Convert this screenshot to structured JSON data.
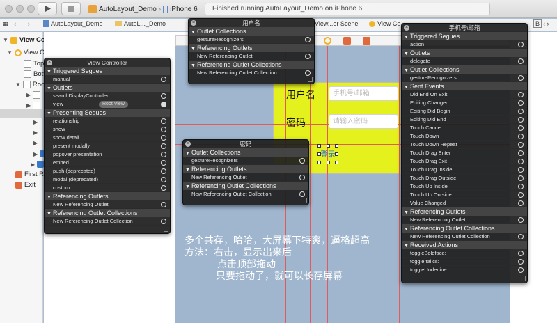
{
  "toolbar": {
    "scheme_project": "AutoLayout_Demo",
    "scheme_device": "iPhone 6",
    "status": "Finished running AutoLayout_Demo on iPhone 6"
  },
  "jumpbar": {
    "items": [
      "AutoLayout_Demo",
      "AutoL..._Demo",
      "View...er Scene",
      "View Co"
    ],
    "right_letter": "B",
    "right_text": "‹ ›"
  },
  "outline": {
    "scene_title": "View Controller Scene",
    "view_controller": "View Controller",
    "item_top": "Top",
    "item_bottom": "Bott",
    "item_root": "Roo",
    "item_first_responder": "First R",
    "item_exit": "Exit"
  },
  "canvas": {
    "username_label": "用户名",
    "username_placeholder": "手机号\\邮箱",
    "password_label": "密码",
    "password_placeholder": "请输入密码",
    "login_button": "登录"
  },
  "panel_vc": {
    "title": "View Controller",
    "sections": [
      {
        "label": "Triggered Segues",
        "rows": [
          {
            "label": "manual",
            "connected": false
          }
        ]
      },
      {
        "label": "Outlets",
        "rows": [
          {
            "label": "searchDisplayController",
            "connected": false
          },
          {
            "label": "view",
            "connected": true,
            "pill": "Root View"
          }
        ]
      },
      {
        "label": "Presenting Segues",
        "rows": [
          {
            "label": "relationship",
            "connected": false
          },
          {
            "label": "show",
            "connected": false
          },
          {
            "label": "show detail",
            "connected": false
          },
          {
            "label": "present modally",
            "connected": false
          },
          {
            "label": "popover presentation",
            "connected": false
          },
          {
            "label": "embed",
            "connected": false
          },
          {
            "label": "push (deprecated)",
            "connected": false
          },
          {
            "label": "modal (deprecated)",
            "connected": false
          },
          {
            "label": "custom",
            "connected": false
          }
        ]
      },
      {
        "label": "Referencing Outlets",
        "rows": [
          {
            "label": "New Referencing Outlet",
            "connected": false
          }
        ]
      },
      {
        "label": "Referencing Outlet Collections",
        "rows": [
          {
            "label": "New Referencing Outlet Collection",
            "connected": false
          }
        ]
      }
    ]
  },
  "panel_username": {
    "title": "用户名",
    "sections": [
      {
        "label": "Outlet Collections",
        "rows": [
          {
            "label": "gestureRecognizers",
            "connected": false
          }
        ]
      },
      {
        "label": "Referencing Outlets",
        "rows": [
          {
            "label": "New Referencing Outlet",
            "connected": false
          }
        ]
      },
      {
        "label": "Referencing Outlet Collections",
        "rows": [
          {
            "label": "New Referencing Outlet Collection",
            "connected": false
          }
        ]
      }
    ]
  },
  "panel_password": {
    "title": "密码",
    "sections": [
      {
        "label": "Outlet Collections",
        "rows": [
          {
            "label": "gestureRecognizers",
            "connected": false
          }
        ]
      },
      {
        "label": "Referencing Outlets",
        "rows": [
          {
            "label": "New Referencing Outlet",
            "connected": false
          }
        ]
      },
      {
        "label": "Referencing Outlet Collections",
        "rows": [
          {
            "label": "New Referencing Outlet Collection",
            "connected": false
          }
        ]
      }
    ]
  },
  "panel_phone": {
    "title": "手机号\\邮箱",
    "sections": [
      {
        "label": "Triggered Segues",
        "rows": [
          {
            "label": "action",
            "connected": false
          }
        ]
      },
      {
        "label": "Outlets",
        "rows": [
          {
            "label": "delegate",
            "connected": false
          }
        ]
      },
      {
        "label": "Outlet Collections",
        "rows": [
          {
            "label": "gestureRecognizers",
            "connected": false
          }
        ]
      },
      {
        "label": "Sent Events",
        "rows": [
          {
            "label": "Did End On Exit",
            "connected": false
          },
          {
            "label": "Editing Changed",
            "connected": false
          },
          {
            "label": "Editing Did Begin",
            "connected": false
          },
          {
            "label": "Editing Did End",
            "connected": false
          },
          {
            "label": "Touch Cancel",
            "connected": false
          },
          {
            "label": "Touch Down",
            "connected": false
          },
          {
            "label": "Touch Down Repeat",
            "connected": false
          },
          {
            "label": "Touch Drag Enter",
            "connected": false
          },
          {
            "label": "Touch Drag Exit",
            "connected": false
          },
          {
            "label": "Touch Drag Inside",
            "connected": false
          },
          {
            "label": "Touch Drag Outside",
            "connected": false
          },
          {
            "label": "Touch Up Inside",
            "connected": false
          },
          {
            "label": "Touch Up Outside",
            "connected": false
          },
          {
            "label": "Value Changed",
            "connected": false
          }
        ]
      },
      {
        "label": "Referencing Outlets",
        "rows": [
          {
            "label": "New Referencing Outlet",
            "connected": false
          }
        ]
      },
      {
        "label": "Referencing Outlet Collections",
        "rows": [
          {
            "label": "New Referencing Outlet Collection",
            "connected": false
          }
        ]
      },
      {
        "label": "Received Actions",
        "rows": [
          {
            "label": "toggleBoldface:",
            "connected": false
          },
          {
            "label": "toggleItalics:",
            "connected": false
          },
          {
            "label": "toggleUnderline:",
            "connected": false
          }
        ]
      }
    ]
  },
  "annotation": {
    "line1": "多个共存，哈哈，大屏幕下特爽，逼格超高",
    "line2": "方法：右击，显示出来后",
    "line3": "点击顶部拖动",
    "line4": "只要拖动了，就可以长存屏幕"
  },
  "colors": {
    "yellow_view": "#e4f11d",
    "scene_bg": "#9fb6ce",
    "hud_bg": "#1e1e1e",
    "constraint_red": "#e25a5a"
  }
}
